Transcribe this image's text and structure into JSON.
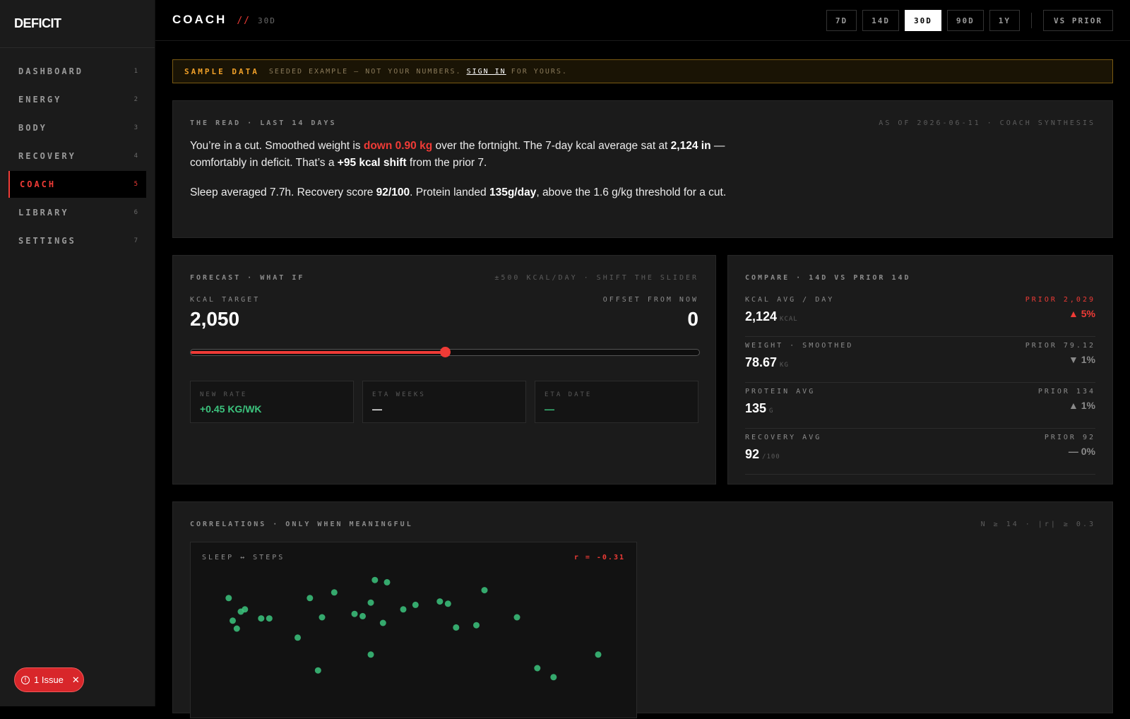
{
  "brand": "DEFICIT",
  "nav": [
    {
      "label": "DASHBOARD",
      "num": "1"
    },
    {
      "label": "ENERGY",
      "num": "2"
    },
    {
      "label": "BODY",
      "num": "3"
    },
    {
      "label": "RECOVERY",
      "num": "4"
    },
    {
      "label": "COACH",
      "num": "5"
    },
    {
      "label": "LIBRARY",
      "num": "6"
    },
    {
      "label": "SETTINGS",
      "num": "7"
    }
  ],
  "issue": {
    "label": "1 Issue"
  },
  "header": {
    "title": "COACH",
    "slash": "//",
    "period": "30D"
  },
  "ranges": [
    "7D",
    "14D",
    "30D",
    "90D",
    "1Y"
  ],
  "compare_toggle": "VS PRIOR",
  "banner": {
    "tag": "SAMPLE DATA",
    "pre": "SEEDED EXAMPLE — NOT YOUR NUMBERS.",
    "link": "SIGN IN",
    "post": "FOR YOURS."
  },
  "read": {
    "title": "THE READ · LAST 14 DAYS",
    "meta": "AS OF 2026-06-11 · COACH SYNTHESIS",
    "p1": {
      "a": "You’re in a cut. Smoothed weight is ",
      "b": "down 0.90 kg",
      "c": " over the fortnight. The 7-day kcal average sat at ",
      "d": "2,124 in",
      "e": " — comfortably in deficit. That’s a ",
      "f": "+95 kcal shift",
      "g": " from the prior 7."
    },
    "p2": {
      "a": "Sleep averaged 7.7h. Recovery score ",
      "b": "92/100",
      "c": ". Protein landed ",
      "d": "135g/day",
      "e": ", above the 1.6 g/kg threshold for a cut."
    }
  },
  "forecast": {
    "title": "FORECAST · WHAT IF",
    "meta": "±500 KCAL/DAY · SHIFT THE SLIDER",
    "target_label": "KCAL TARGET",
    "target_value": "2,050",
    "offset_label": "OFFSET FROM NOW",
    "offset_value": "0",
    "slider_min": -500,
    "slider_max": 500,
    "slider_value": 0,
    "boxes": [
      {
        "label": "NEW RATE",
        "value": "+0.45 KG/WK"
      },
      {
        "label": "ETA WEEKS",
        "value": "—"
      },
      {
        "label": "ETA DATE",
        "value": "—"
      }
    ]
  },
  "compare": {
    "title": "COMPARE · 14D VS PRIOR 14D",
    "rows": [
      {
        "label": "KCAL AVG / DAY",
        "value": "2,124",
        "unit": "KCAL",
        "prior": "PRIOR 2,029",
        "delta": "▲ 5%"
      },
      {
        "label": "WEIGHT · SMOOTHED",
        "value": "78.67",
        "unit": "KG",
        "prior": "PRIOR 79.12",
        "delta": "▼ 1%"
      },
      {
        "label": "PROTEIN AVG",
        "value": "135",
        "unit": "G",
        "prior": "PRIOR 134",
        "delta": "▲ 1%"
      },
      {
        "label": "RECOVERY AVG",
        "value": "92",
        "unit": "/100",
        "prior": "PRIOR 92",
        "delta": "— 0%"
      }
    ]
  },
  "correlations": {
    "title": "CORRELATIONS · ONLY WHEN MEANINGFUL",
    "meta": "N ≥ 14 · |r| ≥ 0.3",
    "card_title": "SLEEP ↔ STEPS",
    "r_label": "r = -0.31"
  },
  "colors": {
    "accent": "#ef3b36",
    "positive": "#3cc47e",
    "warning": "#f0a028"
  },
  "chart_data": {
    "type": "scatter",
    "title": "SLEEP ↔ STEPS",
    "points": [
      [
        0.05,
        0.82
      ],
      [
        0.06,
        0.62
      ],
      [
        0.07,
        0.55
      ],
      [
        0.08,
        0.7
      ],
      [
        0.09,
        0.72
      ],
      [
        0.13,
        0.64
      ],
      [
        0.15,
        0.64
      ],
      [
        0.22,
        0.47
      ],
      [
        0.25,
        0.82
      ],
      [
        0.27,
        0.18
      ],
      [
        0.28,
        0.65
      ],
      [
        0.31,
        0.87
      ],
      [
        0.36,
        0.68
      ],
      [
        0.38,
        0.66
      ],
      [
        0.4,
        0.78
      ],
      [
        0.4,
        0.32
      ],
      [
        0.41,
        0.98
      ],
      [
        0.43,
        0.6
      ],
      [
        0.44,
        0.96
      ],
      [
        0.48,
        0.72
      ],
      [
        0.51,
        0.76
      ],
      [
        0.57,
        0.79
      ],
      [
        0.59,
        0.77
      ],
      [
        0.61,
        0.56
      ],
      [
        0.66,
        0.58
      ],
      [
        0.68,
        0.89
      ],
      [
        0.76,
        0.65
      ],
      [
        0.81,
        0.2
      ],
      [
        0.85,
        0.12
      ],
      [
        0.96,
        0.32
      ]
    ],
    "xlim": [
      0,
      1
    ],
    "ylim": [
      0,
      1
    ],
    "grid": false
  }
}
